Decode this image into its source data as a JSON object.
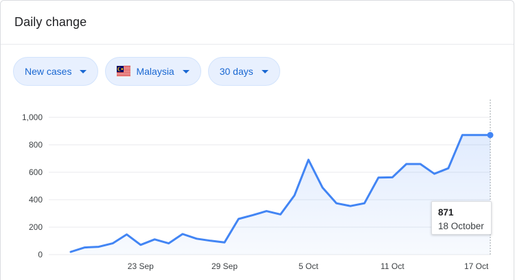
{
  "header": {
    "title": "Daily change"
  },
  "filters": {
    "metric": "New cases",
    "country": "Malaysia",
    "range": "30 days"
  },
  "tooltip": {
    "value": "871",
    "date": "18 October"
  },
  "colors": {
    "line": "#4285f4",
    "chip_bg": "#e8f0fe",
    "chip_text": "#1967d2"
  },
  "chart_data": {
    "type": "line",
    "series": [
      {
        "x": [
          "2020-09-18",
          "2020-09-19",
          "2020-09-20",
          "2020-09-21",
          "2020-09-22",
          "2020-09-23",
          "2020-09-24",
          "2020-09-25",
          "2020-09-26",
          "2020-09-27",
          "2020-09-28",
          "2020-09-29",
          "2020-09-30",
          "2020-10-01",
          "2020-10-02",
          "2020-10-03",
          "2020-10-04",
          "2020-10-05",
          "2020-10-06",
          "2020-10-07",
          "2020-10-08",
          "2020-10-09",
          "2020-10-10",
          "2020-10-11",
          "2020-10-12",
          "2020-10-13",
          "2020-10-14",
          "2020-10-15",
          "2020-10-16",
          "2020-10-17",
          "2020-10-18"
        ],
        "y": [
          20,
          52,
          57,
          82,
          147,
          71,
          111,
          82,
          150,
          116,
          101,
          89,
          260,
          287,
          317,
          293,
          432,
          691,
          489,
          374,
          354,
          374,
          561,
          563,
          660,
          660,
          589,
          629,
          871,
          871,
          871
        ]
      }
    ],
    "x_tick_labels": [
      "23 Sep",
      "29 Sep",
      "5 Oct",
      "11 Oct",
      "17 Oct"
    ],
    "y_tick_labels": [
      "0",
      "200",
      "400",
      "600",
      "800",
      "1,000"
    ],
    "ylim": [
      0,
      1000
    ],
    "grid": true,
    "highlighted_point": {
      "x": "2020-10-18",
      "y": 871
    }
  }
}
